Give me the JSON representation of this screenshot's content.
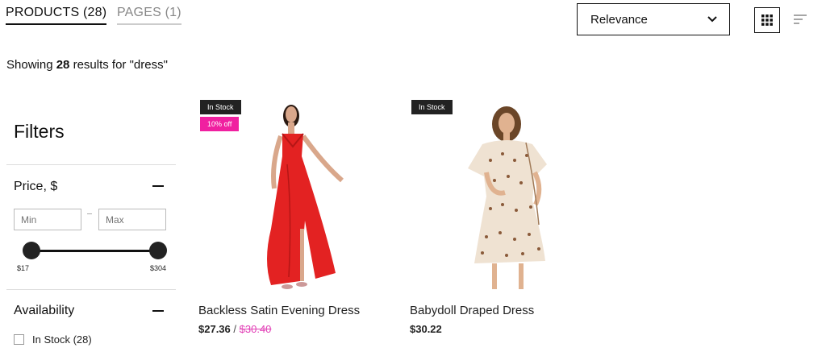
{
  "tabs": [
    {
      "label": "PRODUCTS (28)"
    },
    {
      "label": "PAGES (1)"
    }
  ],
  "sort": {
    "selected": "Relevance"
  },
  "results": {
    "prefix": "Showing ",
    "count": "28",
    "suffix": " results for \"dress\""
  },
  "filters": {
    "title": "Filters",
    "price": {
      "title": "Price, $",
      "min_placeholder": "Min",
      "max_placeholder": "Max",
      "range_min_label": "$17",
      "range_max_label": "$304"
    },
    "availability": {
      "title": "Availability",
      "options": [
        {
          "label": "In Stock (28)"
        }
      ]
    }
  },
  "products": [
    {
      "badge_stock": "In Stock",
      "badge_discount": "10% off",
      "name": "Backless Satin Evening Dress",
      "price": "$27.36",
      "separator": "/",
      "compare_price": "$30.40"
    },
    {
      "badge_stock": "In Stock",
      "name": "Babydoll Draped Dress",
      "price": "$30.22"
    }
  ],
  "colors": {
    "accent_pink": "#f020a0",
    "dark": "#222222"
  }
}
